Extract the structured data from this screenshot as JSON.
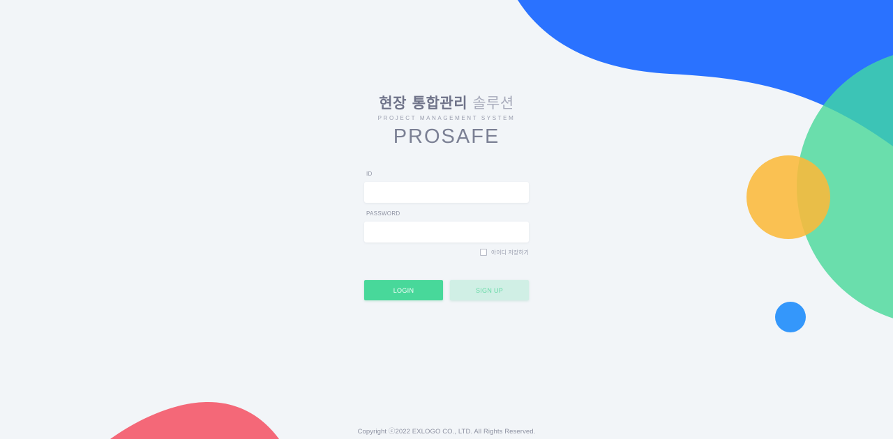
{
  "brand": {
    "title_strong": "현장 통합관리",
    "title_light": "솔루션",
    "subtitle": "PROJECT MANAGEMENT SYSTEM",
    "name": "PROSAFE"
  },
  "login_form": {
    "id_label": "ID",
    "id_value": "",
    "password_label": "PASSWORD",
    "password_value": "",
    "remember_label": "아이디 저장하기",
    "remember_checked": false,
    "login_button": "LOGIN",
    "signup_button": "SIGN UP"
  },
  "footer": {
    "copyright": "Copyright ⓒ2022 EXLOGO CO., LTD. All Rights Reserved."
  },
  "colors": {
    "background": "#f2f5f8",
    "blue_blob": "#2a72ff",
    "green_circle": "#5edcaa",
    "teal_overlap": "#3dc4b4",
    "orange_circle": "#fbbd42",
    "small_blue_circle": "#3497fb",
    "red_blob": "#f46878",
    "login_button": "#48d89a",
    "signup_button": "#d0efe5"
  }
}
